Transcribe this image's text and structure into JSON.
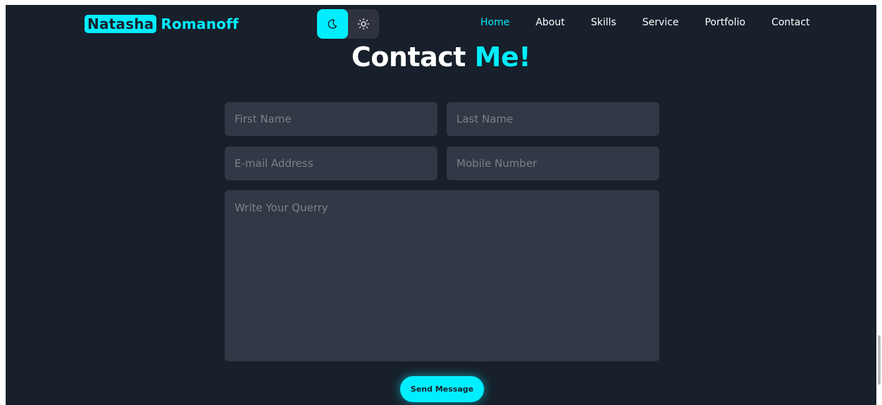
{
  "header": {
    "logo_first": "Natasha",
    "logo_second": "Romanoff",
    "nav": [
      {
        "label": "Home",
        "active": true
      },
      {
        "label": "About"
      },
      {
        "label": "Skills"
      },
      {
        "label": "Service"
      },
      {
        "label": "Portfolio"
      },
      {
        "label": "Contact"
      }
    ]
  },
  "theme_toggle": {
    "dark_icon": "moon-icon",
    "light_icon": "sun-icon",
    "active": "dark"
  },
  "contact": {
    "title_main": "Contact",
    "title_accent": "Me!",
    "placeholders": {
      "first_name": "First Name",
      "last_name": "Last Name",
      "email": "E-mail Address",
      "mobile": "Mobile Number",
      "query": "Write Your Querry"
    },
    "send_label": "Send Message"
  },
  "colors": {
    "accent": "#00eeff",
    "background": "#17202b",
    "field": "#323845"
  }
}
